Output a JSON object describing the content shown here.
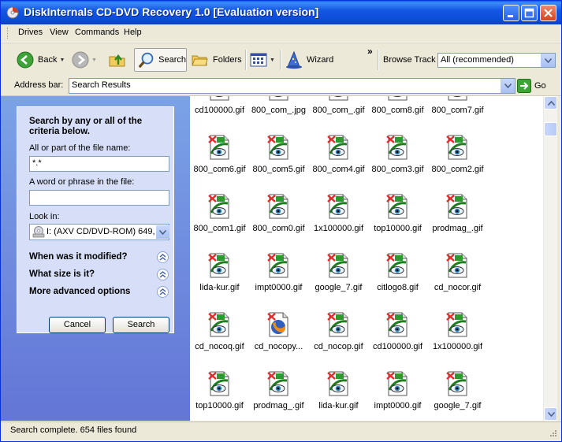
{
  "window": {
    "title": "DiskInternals CD-DVD Recovery 1.0 [Evaluation version]"
  },
  "menu": [
    "Drives",
    "View",
    "Commands",
    "Help"
  ],
  "toolbar": {
    "back_label": "Back",
    "search_label": "Search",
    "folders_label": "Folders",
    "wizard_label": "Wizard",
    "overflow_label": "»",
    "browse_track_label": "Browse Track",
    "browse_track_value": "All (recommended)"
  },
  "address": {
    "label": "Address bar:",
    "value": "Search Results",
    "go_label": "Go"
  },
  "search": {
    "title": "Search by any or all of the criteria below.",
    "filename_label": "All or part of the file name:",
    "filename_value": "*.*",
    "phrase_label": "A word or phrase in the file:",
    "phrase_value": "",
    "lookin_label": "Look in:",
    "lookin_value": "I: (AXV  CD/DVD-ROM) 649,...",
    "options": [
      "When was it modified?",
      "What size is it?",
      "More advanced options"
    ],
    "cancel_label": "Cancel",
    "search_label": "Search"
  },
  "files": [
    [
      "cd100000.gif",
      "800_com_.jpg",
      "800_com_.gif",
      "800_com8.gif",
      "800_com7.gif"
    ],
    [
      "800_com6.gif",
      "800_com5.gif",
      "800_com4.gif",
      "800_com3.gif",
      "800_com2.gif"
    ],
    [
      "800_com1.gif",
      "800_com0.gif",
      "1x100000.gif",
      "top10000.gif",
      "prodmag_.gif"
    ],
    [
      "lida-kur.gif",
      "impt0000.gif",
      "google_7.gif",
      "citlogo8.gif",
      "cd_nocor.gif"
    ],
    [
      "cd_nocoq.gif",
      "cd_nocopy...",
      "cd_nocop.gif",
      "cd100000.gif",
      "1x100000.gif"
    ],
    [
      "top10000.gif",
      "prodmag_.gif",
      "lida-kur.gif",
      "impt0000.gif",
      "google_7.gif"
    ]
  ],
  "icon_types": [
    [
      "gif",
      "gif",
      "gif",
      "gif",
      "gif"
    ],
    [
      "gif",
      "gif",
      "gif",
      "gif",
      "gif"
    ],
    [
      "gif",
      "gif",
      "gif",
      "gif",
      "gif"
    ],
    [
      "gif",
      "gif",
      "gif",
      "gif",
      "gif"
    ],
    [
      "gif",
      "firefox",
      "gif",
      "gif",
      "gif"
    ],
    [
      "gif",
      "gif",
      "gif",
      "gif",
      "gif"
    ]
  ],
  "status": {
    "text": "Search complete. 654 files found"
  },
  "colors": {
    "title_bar": "#0b4ad6",
    "task_pane": "#7ba2e7",
    "search_box": "#d6dff7",
    "deleted_mark": "#e52b2b"
  }
}
